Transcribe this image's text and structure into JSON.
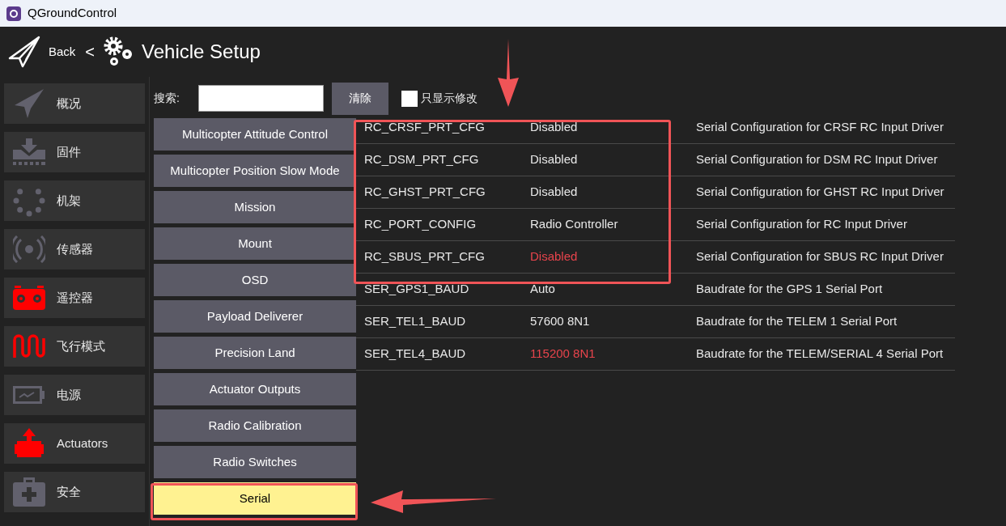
{
  "window": {
    "title": "QGroundControl"
  },
  "header": {
    "back": "Back",
    "separator": "<",
    "title": "Vehicle Setup"
  },
  "sidebar": {
    "items": [
      {
        "label": "概况",
        "attention": false,
        "selected": false
      },
      {
        "label": "固件",
        "attention": false,
        "selected": false
      },
      {
        "label": "机架",
        "attention": false,
        "selected": false
      },
      {
        "label": "传感器",
        "attention": false,
        "selected": false
      },
      {
        "label": "遥控器",
        "attention": true,
        "selected": false
      },
      {
        "label": "飞行模式",
        "attention": true,
        "selected": false
      },
      {
        "label": "电源",
        "attention": false,
        "selected": false
      },
      {
        "label": "Actuators",
        "attention": true,
        "selected": false
      },
      {
        "label": "安全",
        "attention": false,
        "selected": false
      }
    ]
  },
  "search": {
    "label": "搜索:",
    "clear_button": "清除",
    "only_modified": {
      "label": "只显示修改",
      "checked": false
    }
  },
  "groups": [
    {
      "label": "Multicopter Attitude Control",
      "selected": false
    },
    {
      "label": "Multicopter Position Slow Mode",
      "selected": false
    },
    {
      "label": "Mission",
      "selected": false
    },
    {
      "label": "Mount",
      "selected": false
    },
    {
      "label": "OSD",
      "selected": false
    },
    {
      "label": "Payload Deliverer",
      "selected": false
    },
    {
      "label": "Precision Land",
      "selected": false
    },
    {
      "label": "Actuator Outputs",
      "selected": false
    },
    {
      "label": "Radio Calibration",
      "selected": false
    },
    {
      "label": "Radio Switches",
      "selected": false
    },
    {
      "label": "Serial",
      "selected": true
    }
  ],
  "parameters": [
    {
      "name": "RC_CRSF_PRT_CFG",
      "value": "Disabled",
      "description": "Serial Configuration for CRSF RC Input Driver",
      "modified": false
    },
    {
      "name": "RC_DSM_PRT_CFG",
      "value": "Disabled",
      "description": "Serial Configuration for DSM RC Input Driver",
      "modified": false
    },
    {
      "name": "RC_GHST_PRT_CFG",
      "value": "Disabled",
      "description": "Serial Configuration for GHST RC Input Driver",
      "modified": false
    },
    {
      "name": "RC_PORT_CONFIG",
      "value": "Radio Controller",
      "description": "Serial Configuration for RC Input Driver",
      "modified": false
    },
    {
      "name": "RC_SBUS_PRT_CFG",
      "value": "Disabled",
      "description": "Serial Configuration for SBUS RC Input Driver",
      "modified": true
    },
    {
      "name": "SER_GPS1_BAUD",
      "value": "Auto",
      "description": "Baudrate for the GPS 1 Serial Port",
      "modified": false
    },
    {
      "name": "SER_TEL1_BAUD",
      "value": "57600 8N1",
      "description": "Baudrate for the TELEM 1 Serial Port",
      "modified": false
    },
    {
      "name": "SER_TEL4_BAUD",
      "value": "115200 8N1",
      "description": "Baudrate for the TELEM/SERIAL 4 Serial Port",
      "modified": true
    }
  ]
}
